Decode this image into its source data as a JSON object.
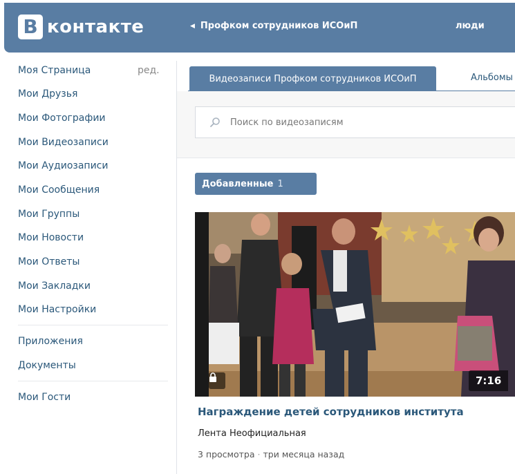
{
  "header": {
    "logo_letter": "В",
    "logo_text": "контакте",
    "back_link": "Профком сотрудников ИСОиП",
    "people_link": "люди"
  },
  "sidebar": {
    "edit_label": "ред.",
    "items": [
      {
        "label": "Моя Страница"
      },
      {
        "label": "Мои Друзья"
      },
      {
        "label": "Мои Фотографии"
      },
      {
        "label": "Мои Видеозаписи"
      },
      {
        "label": "Мои Аудиозаписи"
      },
      {
        "label": "Мои Сообщения"
      },
      {
        "label": "Мои Группы"
      },
      {
        "label": "Мои Новости"
      },
      {
        "label": "Мои Ответы"
      },
      {
        "label": "Мои Закладки"
      },
      {
        "label": "Мои Настройки"
      },
      {
        "label": "Приложения"
      },
      {
        "label": "Документы"
      },
      {
        "label": "Мои Гости"
      }
    ]
  },
  "tabs": {
    "active": "Видеозаписи Профком сотрудников ИСОиП",
    "inactive": "Альбомы"
  },
  "search": {
    "placeholder": "Поиск по видеозаписям"
  },
  "section": {
    "label": "Добавленные",
    "count": "1"
  },
  "video": {
    "duration": "7:16",
    "title": "Награждение детей сотрудников института",
    "author": "Лента Неофициальная",
    "views": "3 просмотра",
    "separator": "·",
    "time": "три месяца назад"
  },
  "colors": {
    "brand": "#597da3",
    "link": "#2b587a"
  }
}
